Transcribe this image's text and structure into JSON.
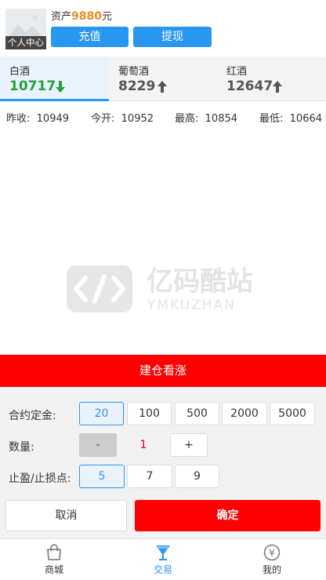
{
  "header": {
    "avatar_label": "个人中心",
    "asset_prefix": "资产",
    "asset_amount": "9880",
    "asset_unit": "元",
    "recharge_label": "充值",
    "withdraw_label": "提现"
  },
  "tabs": [
    {
      "name": "白酒",
      "price": "10717",
      "trend": "down",
      "active": true
    },
    {
      "name": "葡萄酒",
      "price": "8229",
      "trend": "up",
      "active": false
    },
    {
      "name": "红酒",
      "price": "12647",
      "trend": "up",
      "active": false
    }
  ],
  "stats": [
    {
      "label": "昨收:",
      "value": "10949"
    },
    {
      "label": "今开:",
      "value": "10952"
    },
    {
      "label": "最高:",
      "value": "10854"
    },
    {
      "label": "最低:",
      "value": "10664"
    }
  ],
  "watermark": {
    "title": "亿码酷站",
    "subtitle": "YMKUZHAN"
  },
  "action_bar": {
    "label": "建仓看涨"
  },
  "order": {
    "deposit_label": "合约定金:",
    "deposit_options": [
      "20",
      "100",
      "500",
      "2000",
      "5000"
    ],
    "deposit_selected": "20",
    "quantity_label": "数量:",
    "minus_label": "-",
    "quantity_value": "1",
    "plus_label": "+",
    "stop_label": "止盈/止损点:",
    "stop_options": [
      "5",
      "7",
      "9"
    ],
    "stop_selected": "5",
    "cancel_label": "取消",
    "confirm_label": "确定"
  },
  "bottom_nav": [
    {
      "label": "商城",
      "icon": "shopping-bag-icon",
      "active": false
    },
    {
      "label": "交易",
      "icon": "cocktail-glass-icon",
      "active": true
    },
    {
      "label": "我的",
      "icon": "yen-circle-icon",
      "active": false
    }
  ],
  "colors": {
    "accent": "#2897f0",
    "down_green": "#21a23b",
    "action_red": "#ff0000",
    "asset_orange": "#f18b1c"
  }
}
